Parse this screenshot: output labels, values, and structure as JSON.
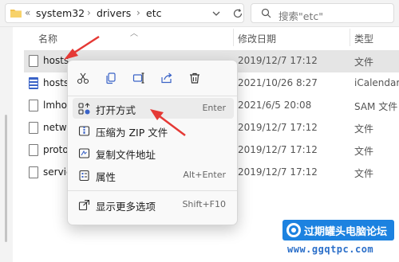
{
  "address": {
    "overflow_glyph": "«",
    "breadcrumbs": [
      "system32",
      "drivers",
      "etc"
    ],
    "separator": "›",
    "search_placeholder": "搜索\"etc\""
  },
  "columns": {
    "name": "名称",
    "modified": "修改日期",
    "type": "类型"
  },
  "files": [
    {
      "name": "hosts",
      "date": "2019/12/7 17:12",
      "type": "文件",
      "icon": "file-icon",
      "selected": true
    },
    {
      "name": "hosts",
      "date": "2021/10/26 8:27",
      "type": "iCalendar F",
      "icon": "calendar-file-icon"
    },
    {
      "name": "lmho",
      "date": "2021/6/5 20:08",
      "type": "SAM 文件",
      "icon": "file-icon"
    },
    {
      "name": "netw",
      "date": "2019/12/7 17:12",
      "type": "文件",
      "icon": "file-icon"
    },
    {
      "name": "proto",
      "date": "2019/12/7 17:12",
      "type": "文件",
      "icon": "file-icon"
    },
    {
      "name": "servic",
      "date": "2019/12/7 17:12",
      "type": "文件",
      "icon": "file-icon"
    }
  ],
  "context_menu": {
    "quick_actions": [
      "cut-icon",
      "copy-icon",
      "rename-icon",
      "share-icon",
      "delete-icon"
    ],
    "items": [
      {
        "label": "打开方式",
        "shortcut": "Enter",
        "icon": "open-with-icon",
        "highlighted": true
      },
      {
        "label": "压缩为 ZIP 文件",
        "shortcut": "",
        "icon": "zip-icon"
      },
      {
        "label": "复制文件地址",
        "shortcut": "",
        "icon": "copy-path-icon"
      },
      {
        "label": "属性",
        "shortcut": "Alt+Enter",
        "icon": "properties-icon"
      },
      {
        "label": "显示更多选项",
        "shortcut": "Shift+F10",
        "icon": "more-options-icon"
      }
    ]
  },
  "watermark": {
    "text": "过期罐头电脑论坛",
    "url": "www.ggqtpc.com"
  },
  "colors": {
    "annotation_arrow": "#e53935",
    "watermark_bg": "#1c82e0",
    "selection_bg": "#e5e5e5"
  }
}
